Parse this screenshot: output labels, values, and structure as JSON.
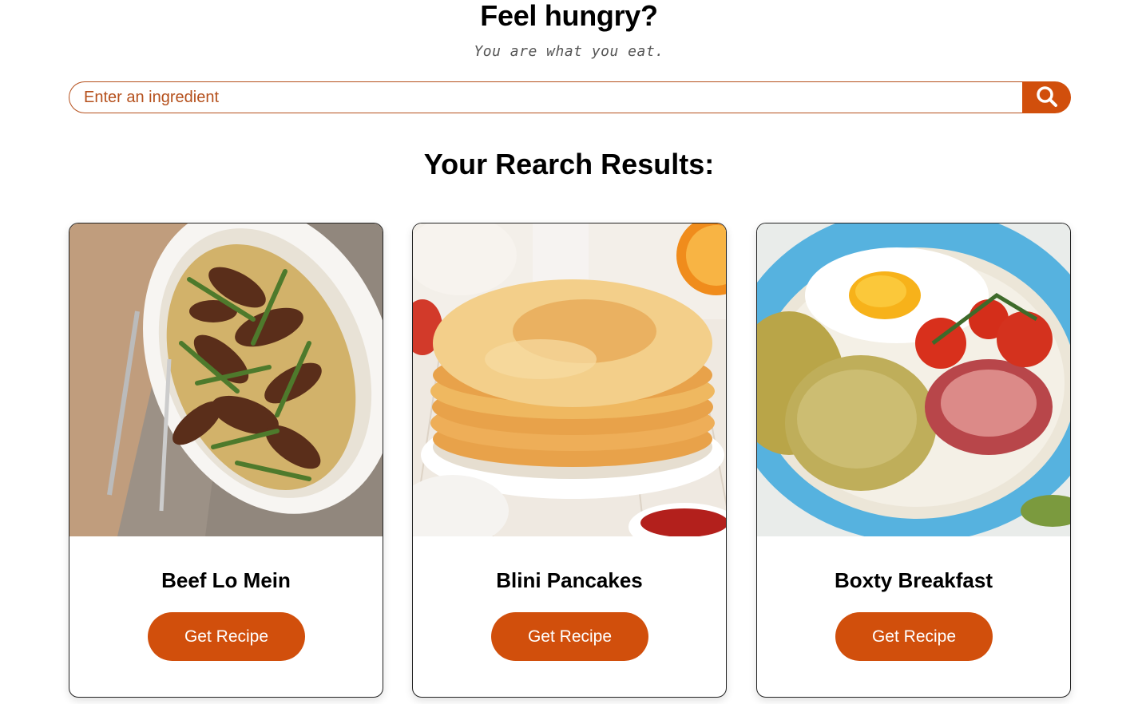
{
  "header": {
    "title": "Feel hungry?",
    "tagline": "You are what you eat."
  },
  "search": {
    "placeholder": "Enter an ingredient",
    "button_icon": "search-icon"
  },
  "results": {
    "title": "Your Rearch Results:",
    "cards": [
      {
        "title": "Beef Lo Mein",
        "button_label": "Get Recipe",
        "image": "beef-lo-mein-photo"
      },
      {
        "title": "Blini Pancakes",
        "button_label": "Get Recipe",
        "image": "blini-pancakes-photo"
      },
      {
        "title": "Boxty Breakfast",
        "button_label": "Get Recipe",
        "image": "boxty-breakfast-photo"
      }
    ]
  },
  "colors": {
    "accent": "#d14f0c",
    "accent_text": "#b5501c"
  }
}
